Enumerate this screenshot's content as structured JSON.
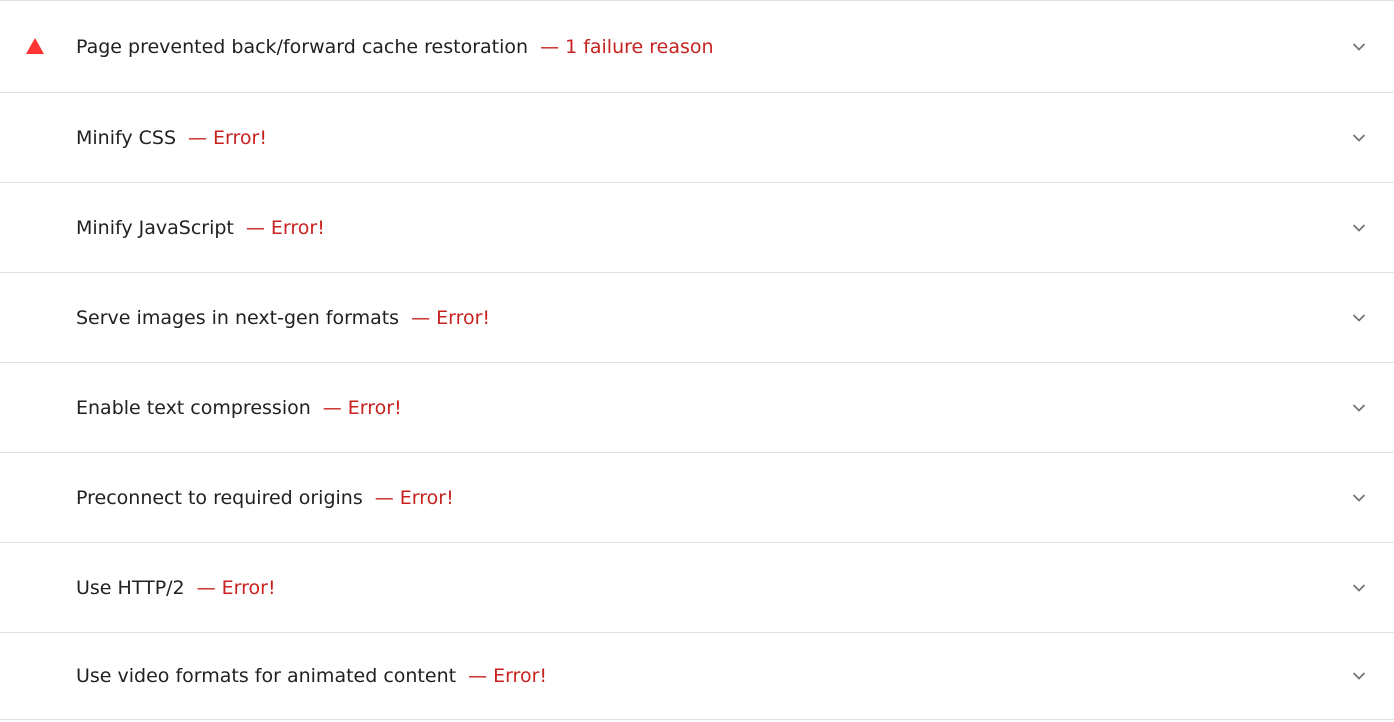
{
  "audits": [
    {
      "title": "Page prevented back/forward cache restoration",
      "separator": "—",
      "status": "1 failure reason",
      "icon": "warning-triangle-icon",
      "status_color": "#c7221f"
    },
    {
      "title": "Minify CSS",
      "separator": "—",
      "status": "Error!"
    },
    {
      "title": "Minify JavaScript",
      "separator": "—",
      "status": "Error!"
    },
    {
      "title": "Serve images in next-gen formats",
      "separator": "—",
      "status": "Error!"
    },
    {
      "title": "Enable text compression",
      "separator": "—",
      "status": "Error!"
    },
    {
      "title": "Preconnect to required origins",
      "separator": "—",
      "status": "Error!"
    },
    {
      "title": "Use HTTP/2",
      "separator": "—",
      "status": "Error!"
    },
    {
      "title": "Use video formats for animated content",
      "separator": "—",
      "status": "Error!"
    }
  ],
  "icons": {
    "warning": "warning-triangle-icon",
    "expand": "chevron-down-icon"
  },
  "colors": {
    "warning_red": "#ff3333",
    "error_text": "#c7221f",
    "divider": "#e0e0e0"
  }
}
